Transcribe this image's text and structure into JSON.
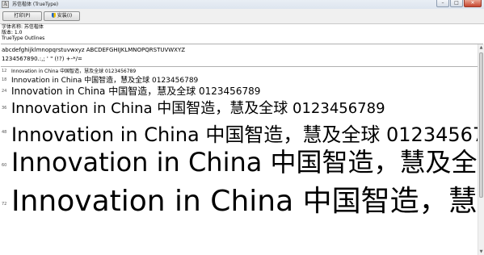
{
  "window": {
    "title": "苏信楷体 (TrueType)",
    "minimize_glyph": "–",
    "maximize_glyph": "□",
    "close_glyph": "✕"
  },
  "toolbar": {
    "print_label": "打印(P)",
    "install_label": "安装(I)"
  },
  "info": {
    "font_name": "字体名称: 苏信楷体",
    "version": "版本: 1.0",
    "type": "TrueType Outlines"
  },
  "charset": {
    "line1": "abcdefghijklmnopqrstuvwxyz ABCDEFGHIJKLMNOPQRSTUVWXYZ",
    "line2": "1234567890.:,; ' \" (!?) +-*/="
  },
  "samples": [
    {
      "size": "12",
      "text": "Innovation in China 中国智造，慧及全球 0123456789"
    },
    {
      "size": "18",
      "text": "Innovation in China 中国智造，慧及全球 0123456789"
    },
    {
      "size": "24",
      "text": "Innovation in China 中国智造，慧及全球 0123456789"
    },
    {
      "size": "36",
      "text": "Innovation in China 中国智造，慧及全球 0123456789"
    },
    {
      "size": "48",
      "text": "Innovation in China 中国智造，慧及全球 0123456789"
    },
    {
      "size": "60",
      "text": "Innovation in China 中国智造，慧及全球 0123456789"
    },
    {
      "size": "72",
      "text": "Innovation in China 中国智造，慧及全球 0123456789"
    }
  ],
  "icons": {
    "app": "font-file-icon",
    "install": "shield-icon"
  }
}
